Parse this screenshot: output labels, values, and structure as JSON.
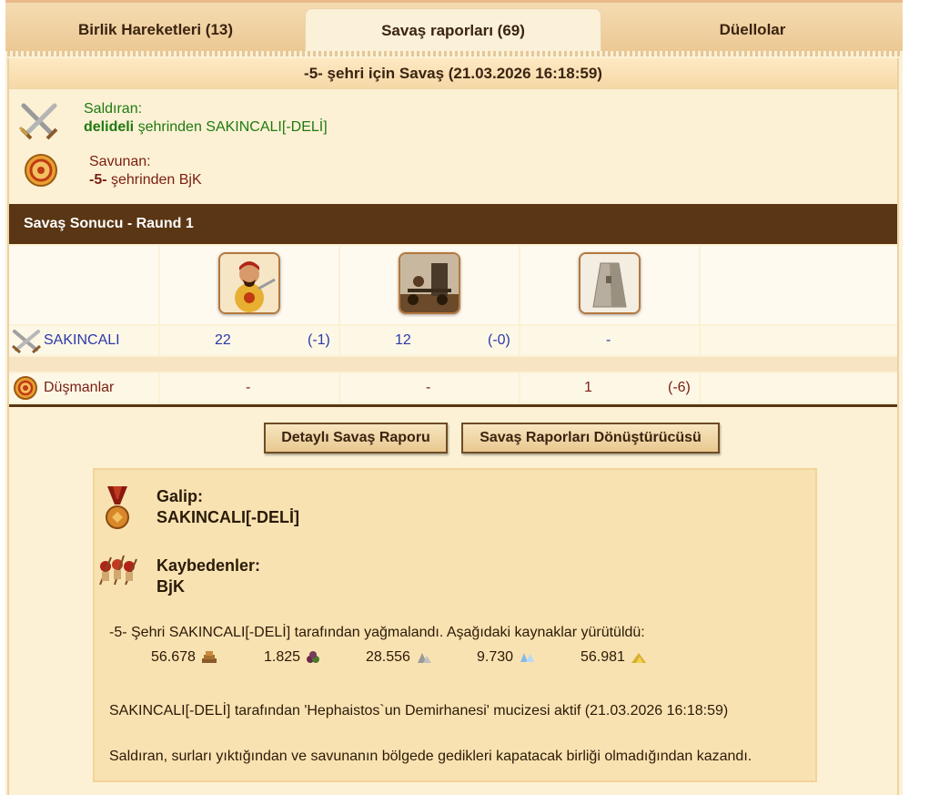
{
  "tabs": [
    {
      "label": "Birlik Hareketleri (13)",
      "active": false
    },
    {
      "label": "Savaş raporları (69)",
      "active": true
    },
    {
      "label": "Düellolar",
      "active": false
    }
  ],
  "report": {
    "title": "-5- şehri için Savaş (21.03.2026 16:18:59)",
    "attacker": {
      "label": "Saldıran:",
      "city": "delideli",
      "rest": " şehrinden SAKINCALI[-DELİ]"
    },
    "defender": {
      "label": "Savunan:",
      "city": "-5-",
      "rest": " şehrinden BjK"
    }
  },
  "round": {
    "title": "Savaş Sonucu - Raund 1",
    "units": [
      "swordsman-unit-icon",
      "catapult-unit-icon",
      "wall-unit-icon"
    ],
    "rows": [
      {
        "name": "SAKINCALI",
        "cells": [
          {
            "count": "22",
            "loss": "(-1)"
          },
          {
            "count": "12",
            "loss": "(-0)"
          },
          {
            "count": "-",
            "loss": ""
          }
        ]
      },
      {
        "name": "Düşmanlar",
        "cells": [
          {
            "count": "-",
            "loss": ""
          },
          {
            "count": "-",
            "loss": ""
          },
          {
            "count": "1",
            "loss": "(-6)"
          }
        ]
      }
    ]
  },
  "buttons": {
    "detailed": "Detaylı Savaş Raporu",
    "converter": "Savaş Raporları Dönüştürücüsü"
  },
  "result": {
    "winner_label": "Galip:",
    "winner": "SAKINCALI[-DELİ]",
    "losers_label": "Kaybedenler:",
    "losers": "BjK",
    "plunder_text": "-5- Şehri SAKINCALI[-DELİ] tarafından yağmalandı. Aşağıdaki kaynaklar yürütüldü:",
    "resources": [
      {
        "value": "56.678",
        "icon": "wood-icon"
      },
      {
        "value": "1.825",
        "icon": "wine-icon"
      },
      {
        "value": "28.556",
        "icon": "marble-icon"
      },
      {
        "value": "9.730",
        "icon": "crystal-icon"
      },
      {
        "value": "56.981",
        "icon": "sulfur-icon"
      }
    ],
    "wonder_text": "SAKINCALI[-DELİ] tarafından 'Hephaistos`un Demirhanesi' mucizesi aktif (21.03.2026 16:18:59)",
    "reason_text": "Saldıran, surları yıktığından ve savunanın bölgede gedikleri kapatacak birliği olmadığından kazandı."
  },
  "colors": {
    "brand_brown": "#5a3614",
    "panel_bg": "#fcf1d4",
    "attacker_green": "#1f7a12",
    "defender_maroon": "#7a1e12"
  }
}
